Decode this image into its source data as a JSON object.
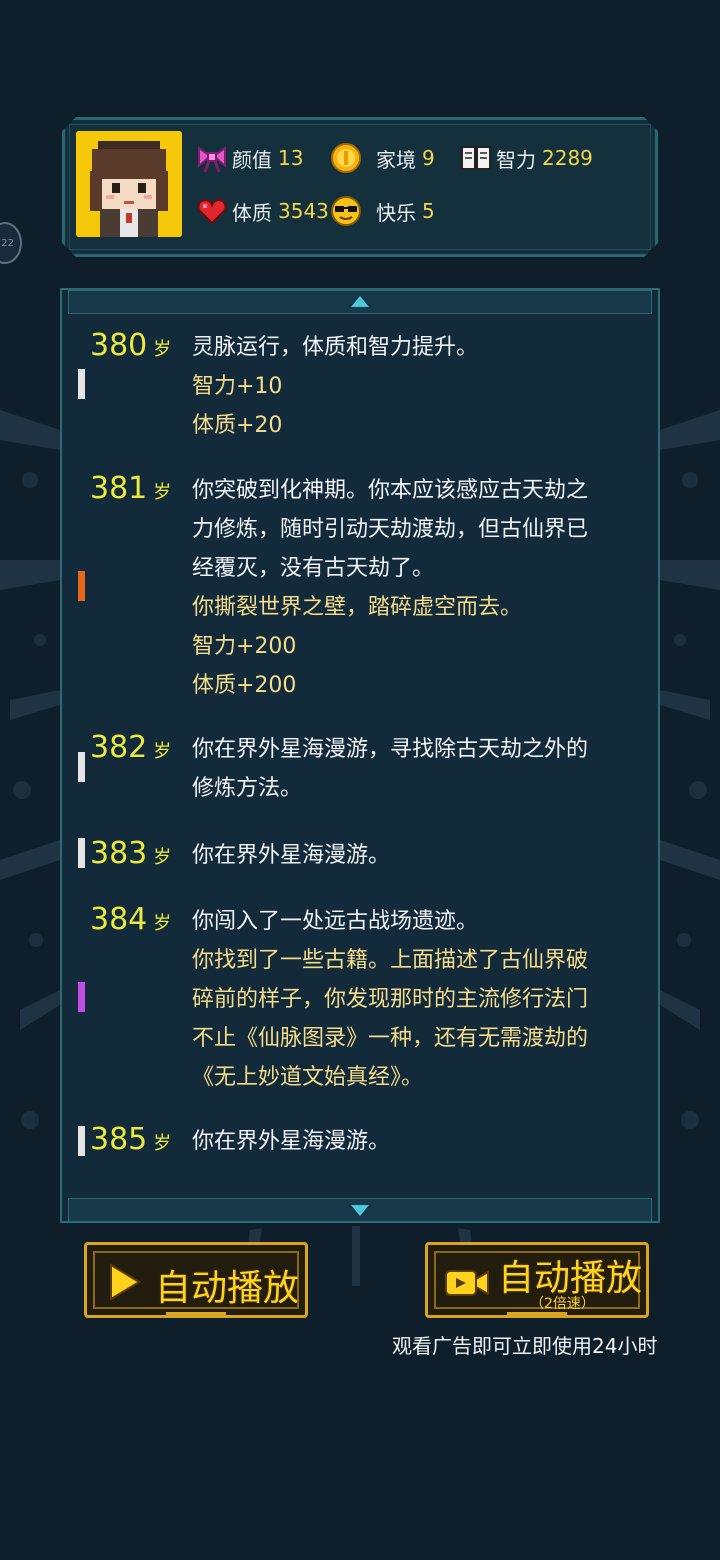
{
  "stats": [
    {
      "label": "颜值",
      "value": "13",
      "icon": "bow-icon"
    },
    {
      "label": "家境",
      "value": "9",
      "icon": "coin-icon"
    },
    {
      "label": "智力",
      "value": "2289",
      "icon": "book-icon"
    },
    {
      "label": "体质",
      "value": "3543",
      "icon": "heart-icon"
    },
    {
      "label": "快乐",
      "value": "5",
      "icon": "sunglasses-face-icon"
    }
  ],
  "side_badge": "22",
  "log": [
    {
      "age": "380",
      "unit": "岁",
      "marker_color": "#e6e6e6",
      "lines": [
        {
          "text": "灵脉运行，体质和智力提升。",
          "color": "white"
        },
        {
          "text": "智力+10",
          "color": "gold"
        },
        {
          "text": "体质+20",
          "color": "gold"
        }
      ]
    },
    {
      "age": "381",
      "unit": "岁",
      "marker_color": "#e8681a",
      "lines": [
        {
          "text": "你突破到化神期。你本应该感应古天劫之",
          "color": "white"
        },
        {
          "text": "力修炼，随时引动天劫渡劫，但古仙界已",
          "color": "white"
        },
        {
          "text": "经覆灭，没有古天劫了。",
          "color": "white"
        },
        {
          "text": "你撕裂世界之壁，踏碎虚空而去。",
          "color": "gold"
        },
        {
          "text": "智力+200",
          "color": "gold"
        },
        {
          "text": "体质+200",
          "color": "gold"
        }
      ]
    },
    {
      "age": "382",
      "unit": "岁",
      "marker_color": "#e6e6e6",
      "lines": [
        {
          "text": "你在界外星海漫游，寻找除古天劫之外的",
          "color": "white"
        },
        {
          "text": "修炼方法。",
          "color": "white"
        }
      ]
    },
    {
      "age": "383",
      "unit": "岁",
      "marker_color": "#e6e6e6",
      "lines": [
        {
          "text": "你在界外星海漫游。",
          "color": "white"
        }
      ]
    },
    {
      "age": "384",
      "unit": "岁",
      "marker_color": "#c24ee6",
      "lines": [
        {
          "text": "你闯入了一处远古战场遗迹。",
          "color": "white"
        },
        {
          "text": "你找到了一些古籍。上面描述了古仙界破",
          "color": "gold"
        },
        {
          "text": "碎前的样子，你发现那时的主流修行法门",
          "color": "gold"
        },
        {
          "text": "不止《仙脉图录》一种，还有无需渡劫的",
          "color": "gold"
        },
        {
          "text": "《无上妙道文始真经》。",
          "color": "gold"
        }
      ]
    },
    {
      "age": "385",
      "unit": "岁",
      "marker_color": "#e6e6e6",
      "lines": [
        {
          "text": "你在界外星海漫游。",
          "color": "white"
        }
      ]
    }
  ],
  "buttons": {
    "auto_play": "自动播放",
    "auto_play_2x": "自动播放",
    "auto_play_2x_sub": "（2倍速）"
  },
  "ad_hint": "观看广告即可立即使用24小时"
}
